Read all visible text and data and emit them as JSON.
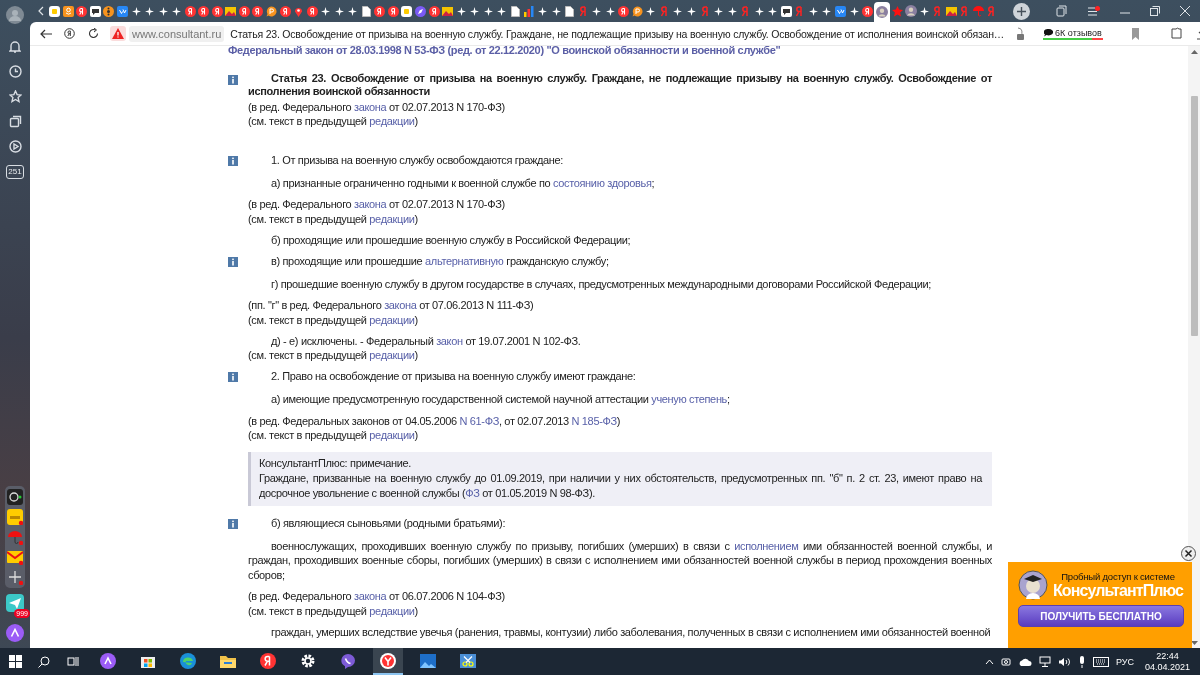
{
  "tabs": [
    {
      "kind": "app",
      "selected": false
    },
    {
      "kind": "ok",
      "selected": false
    },
    {
      "kind": "ya",
      "selected": false
    },
    {
      "kind": "chat",
      "selected": false
    },
    {
      "kind": "film",
      "selected": false
    },
    {
      "kind": "vk",
      "selected": false
    },
    {
      "kind": "star",
      "selected": false
    },
    {
      "kind": "star",
      "selected": false
    },
    {
      "kind": "star",
      "selected": false
    },
    {
      "kind": "star",
      "selected": false
    },
    {
      "kind": "ya",
      "selected": false
    },
    {
      "kind": "ya",
      "selected": false
    },
    {
      "kind": "ya",
      "selected": false
    },
    {
      "kind": "img",
      "selected": false
    },
    {
      "kind": "ya",
      "selected": false
    },
    {
      "kind": "ya",
      "selected": false
    },
    {
      "kind": "pocket",
      "selected": false
    },
    {
      "kind": "ya",
      "selected": false
    },
    {
      "kind": "pin",
      "selected": false
    },
    {
      "kind": "ya",
      "selected": false
    },
    {
      "kind": "star",
      "selected": false
    },
    {
      "kind": "star",
      "selected": false
    },
    {
      "kind": "star",
      "selected": false
    },
    {
      "kind": "doc",
      "selected": false
    },
    {
      "kind": "ya",
      "selected": false
    },
    {
      "kind": "ya",
      "selected": false
    },
    {
      "kind": "app",
      "selected": false
    },
    {
      "kind": "compass",
      "selected": false
    },
    {
      "kind": "ya",
      "selected": false
    },
    {
      "kind": "img",
      "selected": false
    },
    {
      "kind": "star",
      "selected": false
    },
    {
      "kind": "star",
      "selected": false
    },
    {
      "kind": "star",
      "selected": false
    },
    {
      "kind": "star",
      "selected": false
    },
    {
      "kind": "doc",
      "selected": false
    },
    {
      "kind": "bars",
      "selected": false
    },
    {
      "kind": "star",
      "selected": false
    },
    {
      "kind": "star",
      "selected": false
    },
    {
      "kind": "doc",
      "selected": false
    },
    {
      "kind": "letter",
      "selected": false
    },
    {
      "kind": "star",
      "selected": false
    },
    {
      "kind": "star",
      "selected": false
    },
    {
      "kind": "ya",
      "selected": false
    },
    {
      "kind": "pocket",
      "selected": false
    },
    {
      "kind": "star",
      "selected": false
    },
    {
      "kind": "letter",
      "selected": false
    },
    {
      "kind": "star",
      "selected": false
    },
    {
      "kind": "star",
      "selected": false
    },
    {
      "kind": "letter",
      "selected": false
    },
    {
      "kind": "star",
      "selected": false
    },
    {
      "kind": "star",
      "selected": false
    },
    {
      "kind": "letter",
      "selected": false
    },
    {
      "kind": "star",
      "selected": false
    },
    {
      "kind": "star",
      "selected": false
    },
    {
      "kind": "chat",
      "selected": false
    },
    {
      "kind": "letter",
      "selected": false
    },
    {
      "kind": "star",
      "selected": false
    },
    {
      "kind": "star",
      "selected": false
    },
    {
      "kind": "vk",
      "selected": false
    },
    {
      "kind": "star",
      "selected": false
    },
    {
      "kind": "ya",
      "selected": false
    },
    {
      "kind": "avatar",
      "selected": true
    },
    {
      "kind": "redstar",
      "selected": false
    },
    {
      "kind": "avatar",
      "selected": false
    },
    {
      "kind": "star",
      "selected": false
    },
    {
      "kind": "letter",
      "selected": false
    },
    {
      "kind": "img",
      "selected": false
    },
    {
      "kind": "letter",
      "selected": false
    },
    {
      "kind": "umbrella",
      "selected": false
    },
    {
      "kind": "letter",
      "selected": false
    }
  ],
  "toolbar": {
    "site": "www.consultant.ru",
    "page_title": "Статья 23. Освобождение от призыва на военную службу. Граждане, не подлежащие призыву на военную службу. Освобождение от исполнения воинской обязан…",
    "reviews": "6К отзывов"
  },
  "sidebar": {
    "badge": "251",
    "apps_badge": "999"
  },
  "document": {
    "header": "Федеральный закон от 28.03.1998 N 53-ФЗ (ред. от 22.12.2020) \"О воинской обязанности и военной службе\"",
    "paragraphs": [
      {
        "kind": "title",
        "info": true,
        "parts": [
          "Статья 23. Освобождение от призыва на военную службу. Граждане, не подлежащие призыву на военную службу. Освобождение от исполнения воинской обязанности"
        ]
      },
      {
        "kind": "note",
        "info": false,
        "lines": [
          [
            "(в ред. Федерального ",
            {
              "link": "закона"
            },
            " от 02.07.2013 N 170-ФЗ)"
          ],
          [
            "(см. текст в предыдущей ",
            {
              "link": "редакции"
            },
            ")"
          ]
        ]
      },
      {
        "kind": "item",
        "info": true,
        "parts": [
          "1. От призыва на военную службу освобождаются граждане:"
        ]
      },
      {
        "kind": "item",
        "info": false,
        "parts": [
          "а) признанные ограниченно годными к военной службе по ",
          {
            "link": "состоянию здоровья"
          },
          ";"
        ]
      },
      {
        "kind": "note",
        "info": false,
        "lines": [
          [
            "(в ред. Федерального ",
            {
              "link": "закона"
            },
            " от 02.07.2013 N 170-ФЗ)"
          ],
          [
            "(см. текст в предыдущей ",
            {
              "link": "редакции"
            },
            ")"
          ]
        ]
      },
      {
        "kind": "item",
        "info": false,
        "parts": [
          "б) проходящие или прошедшие военную службу в Российской Федерации;"
        ]
      },
      {
        "kind": "item",
        "info": true,
        "parts": [
          "в) проходящие или прошедшие ",
          {
            "link": "альтернативную"
          },
          " гражданскую службу;"
        ]
      },
      {
        "kind": "item",
        "info": false,
        "parts": [
          "г) прошедшие военную службу в другом государстве в случаях, предусмотренных международными договорами Российской Федерации;"
        ]
      },
      {
        "kind": "note",
        "info": false,
        "lines": [
          [
            "(пп. \"г\" в ред. Федерального ",
            {
              "link": "закона"
            },
            " от 07.06.2013 N 111-ФЗ)"
          ],
          [
            "(см. текст в предыдущей ",
            {
              "link": "редакции"
            },
            ")"
          ]
        ]
      },
      {
        "kind": "item",
        "info": false,
        "parts": [
          "д) - е) исключены. - Федеральный ",
          {
            "link": "закон"
          },
          " от 19.07.2001 N 102-ФЗ."
        ]
      },
      {
        "kind": "note",
        "info": false,
        "lines": [
          [
            "(см. текст в предыдущей ",
            {
              "link": "редакции"
            },
            ")"
          ]
        ]
      },
      {
        "kind": "item",
        "info": true,
        "parts": [
          "2. Право на освобождение от призыва на военную службу имеют граждане:"
        ]
      },
      {
        "kind": "item",
        "info": false,
        "parts": [
          "а) имеющие предусмотренную государственной системой научной аттестации ",
          {
            "link": "ученую степень"
          },
          ";"
        ]
      },
      {
        "kind": "note",
        "info": false,
        "lines": [
          [
            "(в ред. Федеральных законов от 04.05.2006 ",
            {
              "link": "N 61-ФЗ"
            },
            ", от 02.07.2013 ",
            {
              "link": "N 185-ФЗ"
            },
            ")"
          ],
          [
            "(см. текст в предыдущей ",
            {
              "link": "редакции"
            },
            ")"
          ]
        ]
      },
      {
        "kind": "remark",
        "info": false,
        "title": "КонсультантПлюс: примечание.",
        "parts": [
          "Граждане, призванные на военную службу до 01.09.2019, при наличии у них обстоятельств, предусмотренных пп. \"б\" п. 2 ст. 23, имеют право на досрочное увольнение с военной службы (",
          {
            "link": "ФЗ"
          },
          " от 01.05.2019 N 98-ФЗ)."
        ]
      },
      {
        "kind": "item",
        "info": true,
        "parts": [
          "б) являющиеся сыновьями (родными братьями):"
        ]
      },
      {
        "kind": "item",
        "info": false,
        "parts": [
          "военнослужащих, проходивших военную службу по призыву, погибших (умерших) в связи с ",
          {
            "link": "исполнением"
          },
          " ими обязанностей военной службы, и граждан, проходивших военные сборы, погибших (умерших) в связи с исполнением ими обязанностей военной службы в период прохождения военных сборов;"
        ]
      },
      {
        "kind": "note",
        "info": false,
        "lines": [
          [
            "(в ред. Федерального ",
            {
              "link": "закона"
            },
            " от 06.07.2006 N 104-ФЗ)"
          ],
          [
            "(см. текст в предыдущей ",
            {
              "link": "редакции"
            },
            ")"
          ]
        ]
      },
      {
        "kind": "item",
        "info": false,
        "parts": [
          "граждан, умерших вследствие увечья (ранения, травмы, контузии) либо заболевания, полученных в связи с исполнением ими обязанностей военной"
        ]
      }
    ]
  },
  "ad": {
    "heading": "Пробный доступ к системе",
    "brand": "КонсультантПлюс",
    "button": "ПОЛУЧИТЬ БЕСПЛАТНО"
  },
  "taskbar": {
    "apps": [
      {
        "kind": "alice",
        "selected": false
      },
      {
        "kind": "store",
        "selected": false
      },
      {
        "kind": "edge",
        "selected": false
      },
      {
        "kind": "folder",
        "selected": false
      },
      {
        "kind": "ya",
        "selected": false
      },
      {
        "kind": "gear",
        "selected": false
      },
      {
        "kind": "viber",
        "selected": false
      },
      {
        "kind": "yabrowser",
        "selected": true
      },
      {
        "kind": "photos",
        "selected": false
      },
      {
        "kind": "snip",
        "selected": false
      }
    ],
    "lang": "РУС",
    "time": "22:44",
    "date": "04.04.2021"
  }
}
